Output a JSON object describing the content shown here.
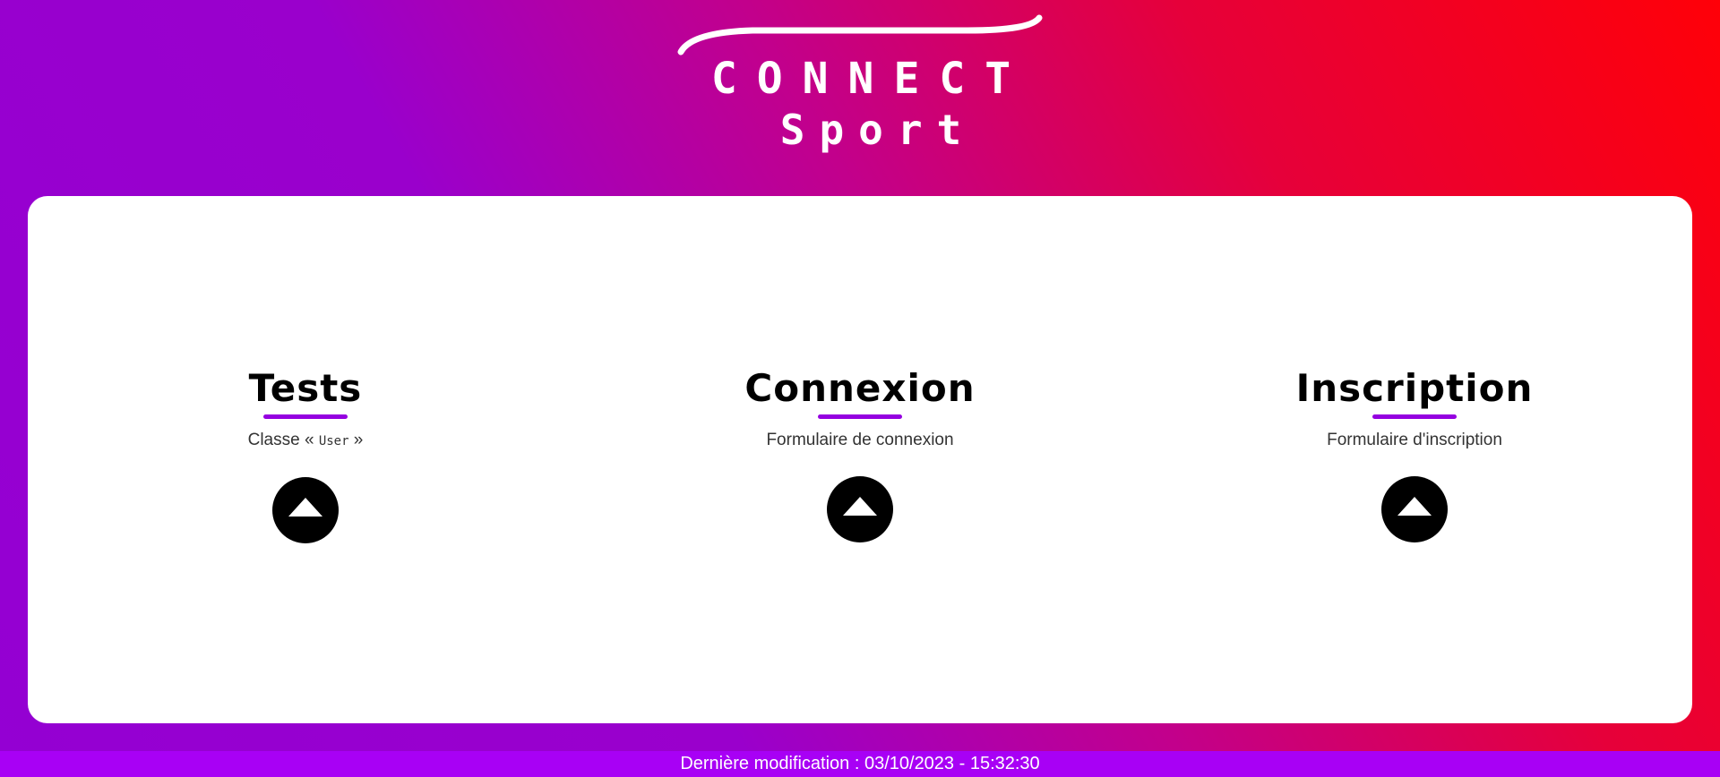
{
  "logo": {
    "line1": "CONNECT",
    "line2": "Sport"
  },
  "columns": [
    {
      "title": "Tests",
      "subtitle_prefix": "Classe « ",
      "subtitle_code": "User",
      "subtitle_suffix": " »",
      "icon": "triangle-up-icon"
    },
    {
      "title": "Connexion",
      "subtitle": "Formulaire de connexion",
      "icon": "triangle-up-icon"
    },
    {
      "title": "Inscription",
      "subtitle": "Formulaire d'inscription",
      "icon": "triangle-up-icon"
    }
  ],
  "footer": {
    "text": "Dernière modification : 03/10/2023 - 15:32:30"
  },
  "colors": {
    "accent": "#9500e0",
    "gradient_start": "#9400d3",
    "gradient_end": "#ff0008",
    "footer_bg": "#a800f5"
  }
}
